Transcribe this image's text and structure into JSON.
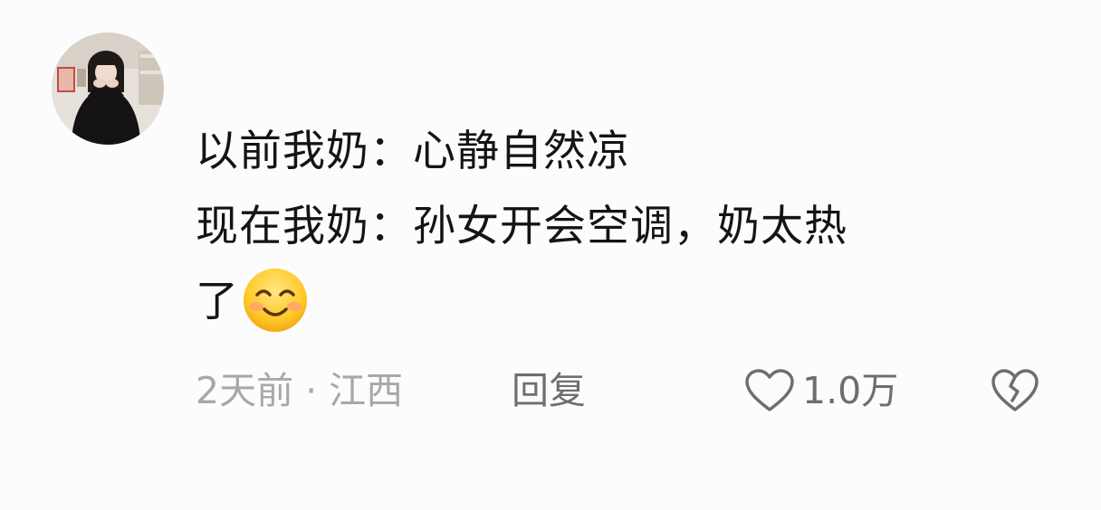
{
  "comment": {
    "avatar": "user-avatar-photo",
    "text_lines": [
      "以前我奶：心静自然凉",
      "现在我奶：孙女开会空调，奶太热",
      "了"
    ],
    "emoji": "smiling-face-emoji",
    "meta": "2天前 · 江西",
    "reply_label": "回复",
    "like_count": "1.0万",
    "like_icon": "heart-outline-icon",
    "dislike_icon": "broken-heart-icon"
  },
  "colors": {
    "background": "#fcfcfc",
    "text": "#141414",
    "meta": "#a8a8a8",
    "action": "#6e6e6e"
  }
}
